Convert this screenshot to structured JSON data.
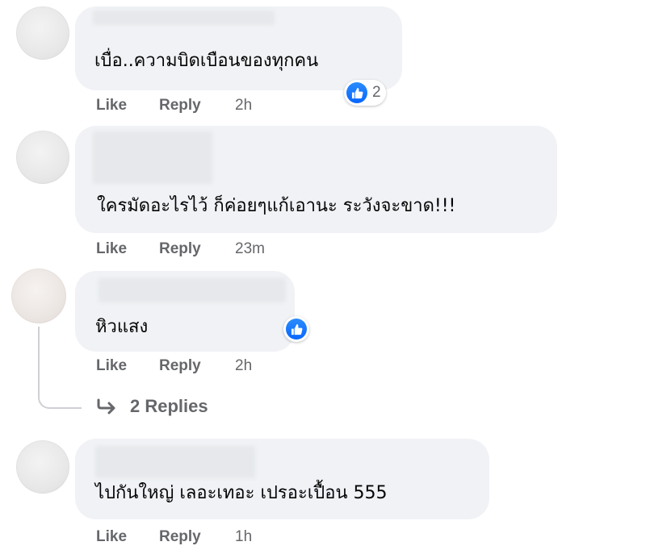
{
  "actions": {
    "like_label": "Like",
    "reply_label": "Reply"
  },
  "comments": [
    {
      "text": "เบื่อ..ความบิดเบือนของทุกคน",
      "time": "2h",
      "reaction_count": "2"
    },
    {
      "text": "ใครมัดอะไรไว้ ก็ค่อยๆแก้เอานะ ระวังจะขาด!!!",
      "time": "23m"
    },
    {
      "text": "หิวแสง",
      "time": "2h"
    },
    {
      "text": "ไปกันใหญ่ เลอะเทอะ เปรอะเปื้อน 555",
      "time": "1h"
    }
  ],
  "replies_link": {
    "label": "2 Replies"
  },
  "colors": {
    "bubble": "#f0f2f5",
    "meta_text": "#65676b",
    "like_blue": "#0866ff"
  },
  "icons": {
    "reaction": "thumbs-up-icon",
    "reply_arrow": "reply-arrow-icon"
  }
}
